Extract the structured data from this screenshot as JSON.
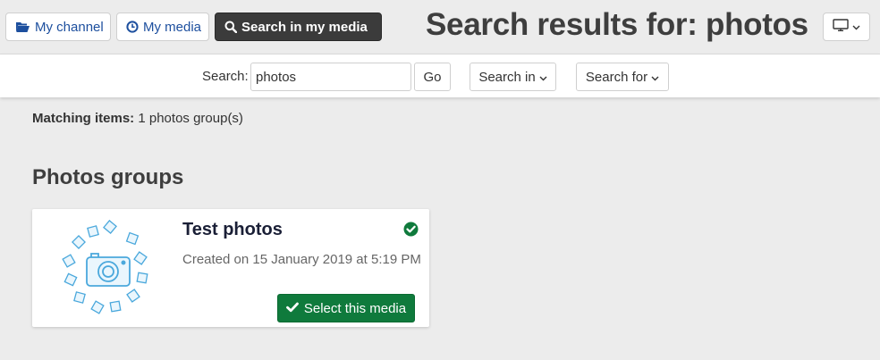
{
  "header": {
    "my_channel_label": "My channel",
    "my_media_label": "My media",
    "search_media_label": "Search in my media",
    "page_title": "Search results for: photos"
  },
  "search": {
    "label": "Search:",
    "value": "photos",
    "go_label": "Go",
    "search_in_label": "Search in",
    "search_for_label": "Search for"
  },
  "results": {
    "matching_label": "Matching items:",
    "matching_value": "1 photos group(s)",
    "section_title": "Photos groups"
  },
  "card": {
    "title": "Test photos",
    "date": "Created on 15 January 2019 at 5:19 PM",
    "select_label": "Select this media"
  },
  "icons": {
    "my_channel": "folder-open-icon",
    "my_media": "clock-icon",
    "search_media": "search-icon",
    "display": "monitor-icon",
    "status": "check-circle-icon",
    "select": "check-icon"
  },
  "colors": {
    "accent_blue": "#1d4f9e",
    "dark_button": "#3b3b3b",
    "success_green": "#0f7a3c",
    "thumb_blue": "#4aa8dc"
  }
}
